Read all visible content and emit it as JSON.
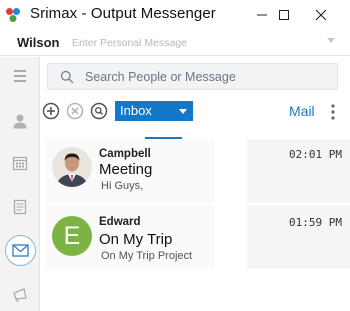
{
  "window": {
    "title": "Srimax - Output Messenger",
    "logo_icon": "output-messenger-logo-icon",
    "controls": [
      "minimize-icon",
      "maximize-icon",
      "close-icon"
    ]
  },
  "profile": {
    "user_name": "Wilson",
    "personal_message_placeholder": "Enter Personal Message"
  },
  "sidebar": {
    "items": [
      {
        "icon": "hamburger-menu-icon"
      },
      {
        "icon": "user-icon"
      },
      {
        "icon": "calendar-icon"
      },
      {
        "icon": "notes-icon"
      },
      {
        "icon": "mail-icon",
        "active": true
      },
      {
        "icon": "announcement-icon"
      }
    ]
  },
  "search": {
    "placeholder": "Search People or Message",
    "icon": "search-icon"
  },
  "toolbar": {
    "actions": [
      "add-icon",
      "delete-icon",
      "search-icon"
    ],
    "folder_selected": "Inbox",
    "mail_link": "Mail",
    "more_icon": "more-vertical-icon"
  },
  "messages": [
    {
      "sender": "Campbell",
      "subject": "Meeting",
      "preview": "Hi Guys,",
      "time": "02:01 PM",
      "avatar": "photo"
    },
    {
      "sender": "Edward",
      "subject": "On My Trip",
      "preview": "On My Trip Project",
      "time": "01:59 PM",
      "avatar": "E",
      "avatar_color": "#7cb342"
    }
  ],
  "colors": {
    "accent": "#1478c8",
    "link": "#1d7ac4"
  }
}
